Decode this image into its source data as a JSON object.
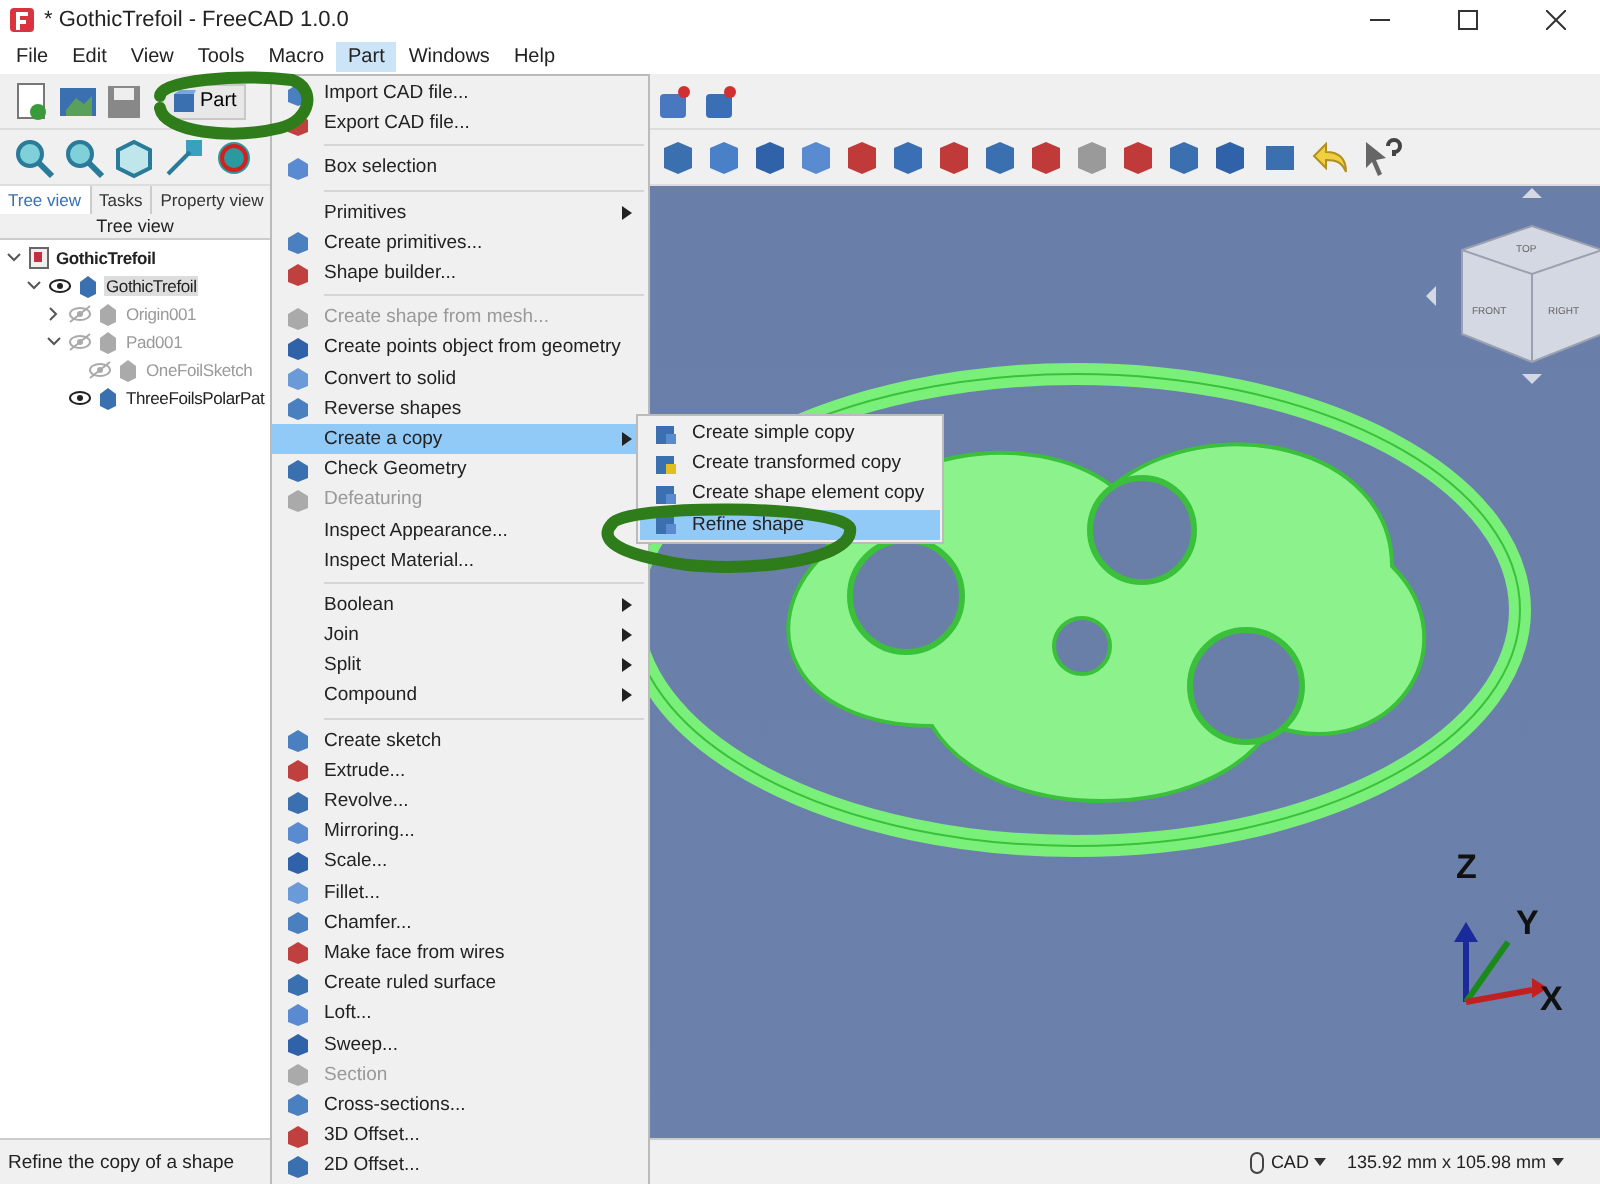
{
  "window": {
    "title": "* GothicTrefoil - FreeCAD 1.0.0"
  },
  "menubar": [
    {
      "label": "File",
      "selected": false
    },
    {
      "label": "Edit",
      "selected": false
    },
    {
      "label": "View",
      "selected": false
    },
    {
      "label": "Tools",
      "selected": false
    },
    {
      "label": "Macro",
      "selected": false
    },
    {
      "label": "Part",
      "selected": true
    },
    {
      "label": "Windows",
      "selected": false
    },
    {
      "label": "Help",
      "selected": false
    }
  ],
  "toolbar": {
    "workbench": "Part"
  },
  "panel": {
    "tabs": [
      {
        "label": "Tree view",
        "selected": true
      },
      {
        "label": "Tasks",
        "selected": false
      },
      {
        "label": "Property view",
        "selected": false
      }
    ],
    "header": "Tree view",
    "tree": [
      {
        "label": "GothicTrefoil",
        "kind": "document",
        "expanded": true,
        "selected": false,
        "dimmed": false,
        "children": [
          {
            "label": "GothicTrefoil",
            "kind": "object",
            "visible": true,
            "expanded": true,
            "selected": true,
            "dimmed": false,
            "children": [
              {
                "label": "Origin001",
                "kind": "object",
                "visible": false,
                "expanded": false,
                "selected": false,
                "dimmed": true
              },
              {
                "label": "Pad001",
                "kind": "object",
                "visible": false,
                "expanded": true,
                "selected": false,
                "dimmed": true,
                "children": [
                  {
                    "label": "OneFoilSketch",
                    "kind": "object",
                    "visible": false,
                    "selected": false,
                    "dimmed": true
                  }
                ]
              },
              {
                "label": "ThreeFoilsPolarPat",
                "kind": "object",
                "visible": true,
                "selected": false,
                "dimmed": false
              }
            ]
          }
        ]
      }
    ]
  },
  "menu": [
    {
      "kind": "item",
      "label": "Import CAD file...",
      "has_icon": true,
      "disabled": false,
      "selected": false
    },
    {
      "kind": "item",
      "label": "Export CAD file...",
      "has_icon": true,
      "disabled": false,
      "selected": false
    },
    {
      "kind": "separator"
    },
    {
      "kind": "item",
      "label": "Box selection",
      "has_icon": true,
      "disabled": false,
      "selected": false
    },
    {
      "kind": "separator"
    },
    {
      "kind": "submenu",
      "label": "Primitives",
      "has_icon": false,
      "disabled": false,
      "selected": false
    },
    {
      "kind": "item",
      "label": "Create primitives...",
      "has_icon": true,
      "disabled": false,
      "selected": false
    },
    {
      "kind": "item",
      "label": "Shape builder...",
      "has_icon": true,
      "disabled": false,
      "selected": false
    },
    {
      "kind": "separator"
    },
    {
      "kind": "item",
      "label": "Create shape from mesh...",
      "has_icon": true,
      "disabled": true,
      "selected": false
    },
    {
      "kind": "item",
      "label": "Create points object from geometry",
      "has_icon": true,
      "disabled": false,
      "selected": false
    },
    {
      "kind": "item",
      "label": "Convert to solid",
      "has_icon": true,
      "disabled": false,
      "selected": false
    },
    {
      "kind": "item",
      "label": "Reverse shapes",
      "has_icon": true,
      "disabled": false,
      "selected": false
    },
    {
      "kind": "submenu",
      "label": "Create a copy",
      "has_icon": false,
      "disabled": false,
      "selected": true
    },
    {
      "kind": "item",
      "label": "Check Geometry",
      "has_icon": true,
      "disabled": false,
      "selected": false
    },
    {
      "kind": "item",
      "label": "Defeaturing",
      "has_icon": true,
      "disabled": true,
      "selected": false
    },
    {
      "kind": "item",
      "label": "Inspect Appearance...",
      "has_icon": false,
      "disabled": false,
      "selected": false
    },
    {
      "kind": "item",
      "label": "Inspect Material...",
      "has_icon": false,
      "disabled": false,
      "selected": false
    },
    {
      "kind": "separator"
    },
    {
      "kind": "submenu",
      "label": "Boolean",
      "has_icon": false,
      "disabled": false,
      "selected": false
    },
    {
      "kind": "submenu",
      "label": "Join",
      "has_icon": false,
      "disabled": false,
      "selected": false
    },
    {
      "kind": "submenu",
      "label": "Split",
      "has_icon": false,
      "disabled": false,
      "selected": false
    },
    {
      "kind": "submenu",
      "label": "Compound",
      "has_icon": false,
      "disabled": false,
      "selected": false
    },
    {
      "kind": "separator"
    },
    {
      "kind": "item",
      "label": "Create sketch",
      "has_icon": true,
      "disabled": false,
      "selected": false
    },
    {
      "kind": "item",
      "label": "Extrude...",
      "has_icon": true,
      "disabled": false,
      "selected": false
    },
    {
      "kind": "item",
      "label": "Revolve...",
      "has_icon": true,
      "disabled": false,
      "selected": false
    },
    {
      "kind": "item",
      "label": "Mirroring...",
      "has_icon": true,
      "disabled": false,
      "selected": false
    },
    {
      "kind": "item",
      "label": "Scale...",
      "has_icon": true,
      "disabled": false,
      "selected": false
    },
    {
      "kind": "item",
      "label": "Fillet...",
      "has_icon": true,
      "disabled": false,
      "selected": false
    },
    {
      "kind": "item",
      "label": "Chamfer...",
      "has_icon": true,
      "disabled": false,
      "selected": false
    },
    {
      "kind": "item",
      "label": "Make face from wires",
      "has_icon": true,
      "disabled": false,
      "selected": false
    },
    {
      "kind": "item",
      "label": "Create ruled surface",
      "has_icon": true,
      "disabled": false,
      "selected": false
    },
    {
      "kind": "item",
      "label": "Loft...",
      "has_icon": true,
      "disabled": false,
      "selected": false
    },
    {
      "kind": "item",
      "label": "Sweep...",
      "has_icon": true,
      "disabled": false,
      "selected": false
    },
    {
      "kind": "item",
      "label": "Section",
      "has_icon": true,
      "disabled": true,
      "selected": false
    },
    {
      "kind": "item",
      "label": "Cross-sections...",
      "has_icon": true,
      "disabled": false,
      "selected": false
    },
    {
      "kind": "item",
      "label": "3D Offset...",
      "has_icon": true,
      "disabled": false,
      "selected": false
    },
    {
      "kind": "item",
      "label": "2D Offset...",
      "has_icon": true,
      "disabled": false,
      "selected": false
    }
  ],
  "submenu": [
    {
      "label": "Create simple copy",
      "selected": false
    },
    {
      "label": "Create transformed copy",
      "selected": false
    },
    {
      "label": "Create shape element copy",
      "selected": false
    },
    {
      "label": "Refine shape",
      "selected": true
    }
  ],
  "viewport": {
    "cube_faces": [
      "TOP",
      "FRONT",
      "RIGHT"
    ],
    "axes": [
      "Z",
      "Y",
      "X"
    ]
  },
  "status_bar": {
    "message": "Refine the copy of a shape",
    "navigation": "CAD",
    "dimensions": "135.92 mm x 105.98 mm"
  }
}
